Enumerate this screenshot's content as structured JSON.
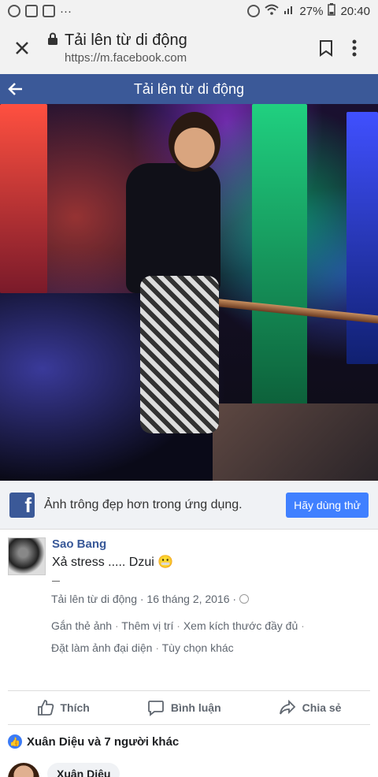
{
  "status": {
    "battery": "27%",
    "time": "20:40",
    "dots": "···"
  },
  "browser": {
    "title": "Tải lên từ di động",
    "url": "https://m.facebook.com"
  },
  "fb_header": {
    "title": "Tải lên từ di động"
  },
  "promo": {
    "text": "Ảnh trông đẹp hơn trong ứng dụng.",
    "button": "Hãy dùng thử",
    "logo_letter": "f"
  },
  "post": {
    "author": "Sao Bang",
    "caption": "Xả stress ..... Dzui 😬",
    "meta": "Tải lên từ di động · 16 tháng 2, 2016 ·",
    "links": [
      "Gắn thẻ ảnh",
      "Thêm vị trí",
      "Xem kích thước đầy đủ",
      "Đặt làm ảnh đại diện",
      "Tùy chọn khác"
    ]
  },
  "actions": {
    "like": "Thích",
    "comment": "Bình luận",
    "share": "Chia sẻ"
  },
  "reactions": {
    "text": "Xuân Diệu và 7 người khác"
  },
  "comment": {
    "author": "Xuân Diệu"
  },
  "colors": {
    "fb_blue": "#3b5998",
    "button_blue": "#4080ff"
  }
}
